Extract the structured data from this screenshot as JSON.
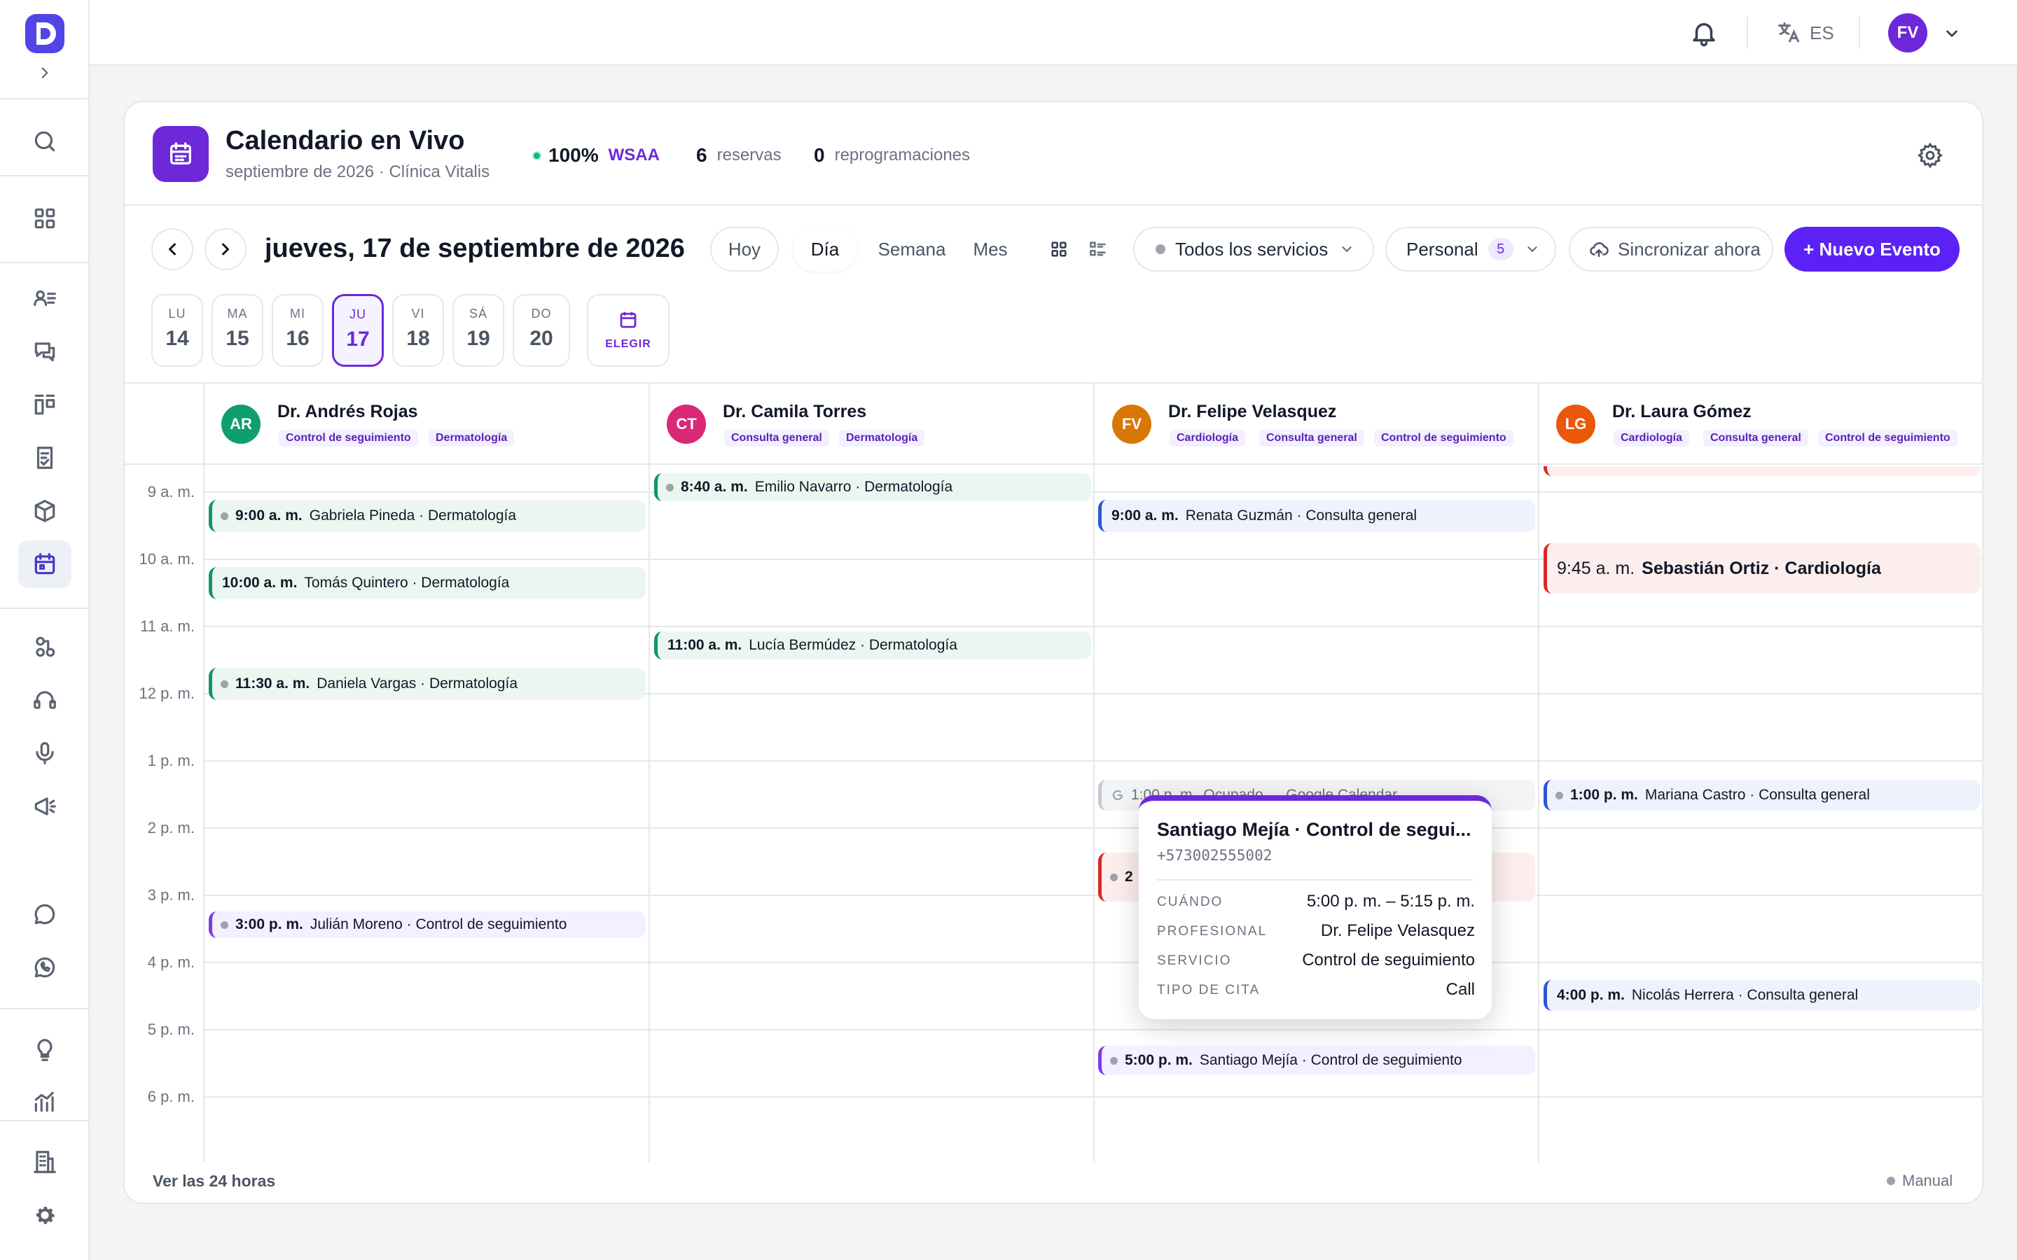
{
  "topbar": {
    "language": "ES",
    "user_initials": "FV"
  },
  "header": {
    "title": "Calendario en Vivo",
    "subtitle": "septiembre de 2026 · Clínica Vitalis",
    "wsaa_percent": "100%",
    "wsaa_label": "WSAA",
    "reservas_count": "6",
    "reservas_label": "reservas",
    "reprog_count": "0",
    "reprog_label": "reprogramaciones"
  },
  "toolbar": {
    "date_title": "jueves, 17 de septiembre de 2026",
    "today": "Hoy",
    "views": [
      "Día",
      "Semana",
      "Mes"
    ],
    "services": "Todos los servicios",
    "staff_label": "Personal",
    "staff_count": "5",
    "sync": "Sincronizar ahora",
    "new_event": "+ Nuevo Evento"
  },
  "days": [
    {
      "label": "LU",
      "num": "14"
    },
    {
      "label": "MA",
      "num": "15"
    },
    {
      "label": "MI",
      "num": "16"
    },
    {
      "label": "JU",
      "num": "17"
    },
    {
      "label": "VI",
      "num": "18"
    },
    {
      "label": "SÁ",
      "num": "19"
    },
    {
      "label": "DO",
      "num": "20"
    }
  ],
  "choose_label": "ELEGIR",
  "hours": [
    "9 a. m.",
    "10 a. m.",
    "11 a. m.",
    "12 p. m.",
    "1 p. m.",
    "2 p. m.",
    "3 p. m.",
    "4 p. m.",
    "5 p. m.",
    "6 p. m."
  ],
  "doctors": [
    {
      "initials": "AR",
      "name": "Dr. Andrés Rojas",
      "color": "#0f9f6e",
      "tags": [
        "Control de seguimiento",
        "Dermatología"
      ]
    },
    {
      "initials": "CT",
      "name": "Dr. Camila Torres",
      "color": "#db2777",
      "tags": [
        "Consulta general",
        "Dermatología"
      ]
    },
    {
      "initials": "FV",
      "name": "Dr. Felipe Velasquez",
      "color": "#d97706",
      "tags": [
        "Cardiología",
        "Consulta general",
        "Control de seguimiento"
      ]
    },
    {
      "initials": "LG",
      "name": "Dr. Laura Gómez",
      "color": "#ea580c",
      "tags": [
        "Cardiología",
        "Consulta general",
        "Control de seguimiento"
      ]
    }
  ],
  "events": {
    "e1": {
      "time": "9:00 a. m.",
      "text": "Gabriela Pineda · Dermatología"
    },
    "e2": {
      "time": "10:00 a. m.",
      "text": "Tomás Quintero · Dermatología"
    },
    "e3": {
      "time": "11:30 a. m.",
      "text": "Daniela Vargas · Dermatología"
    },
    "e4": {
      "time": "3:00 p. m.",
      "text": "Julián Moreno · Control de seguimiento"
    },
    "e5": {
      "time": "8:40 a. m.",
      "text": "Emilio Navarro · Dermatología"
    },
    "e6": {
      "time": "11:00 a. m.",
      "text": "Lucía Bermúdez · Dermatología"
    },
    "e7": {
      "time": "9:00 a. m.",
      "text": "Renata Guzmán · Consulta general"
    },
    "e8": {
      "time": "1:00 p. m.",
      "text": "Ocupado — Google Calendar"
    },
    "e9": {
      "time": "2",
      "text": ""
    },
    "e10": {
      "time": "5:00 p. m.",
      "text": "Santiago Mejía · Control de seguimiento"
    },
    "e11": {
      "time": "9:45 a. m.",
      "text": "Sebastián Ortiz · Cardiología"
    },
    "e12": {
      "time": "1:00 p. m.",
      "text": "Mariana Castro · Consulta general"
    },
    "e13": {
      "time": "4:00 p. m.",
      "text": "Nicolás Herrera · Consulta general"
    }
  },
  "popover": {
    "title": "Santiago Mejía · Control de segui...",
    "phone": "+573002555002",
    "rows": [
      {
        "key": "CUÁNDO",
        "value": "5:00 p. m. – 5:15 p. m."
      },
      {
        "key": "PROFESIONAL",
        "value": "Dr. Felipe Velasquez"
      },
      {
        "key": "SERVICIO",
        "value": "Control de seguimiento"
      },
      {
        "key": "TIPO DE CITA",
        "value": "Call"
      }
    ]
  },
  "footer": {
    "see_all": "Ver las 24 horas",
    "mode": "Manual"
  },
  "colors": {
    "accent": "#5b21f5",
    "green": "#10946b",
    "blue": "#2f55d4",
    "red": "#dc2626",
    "purple": "#7c3aed"
  }
}
